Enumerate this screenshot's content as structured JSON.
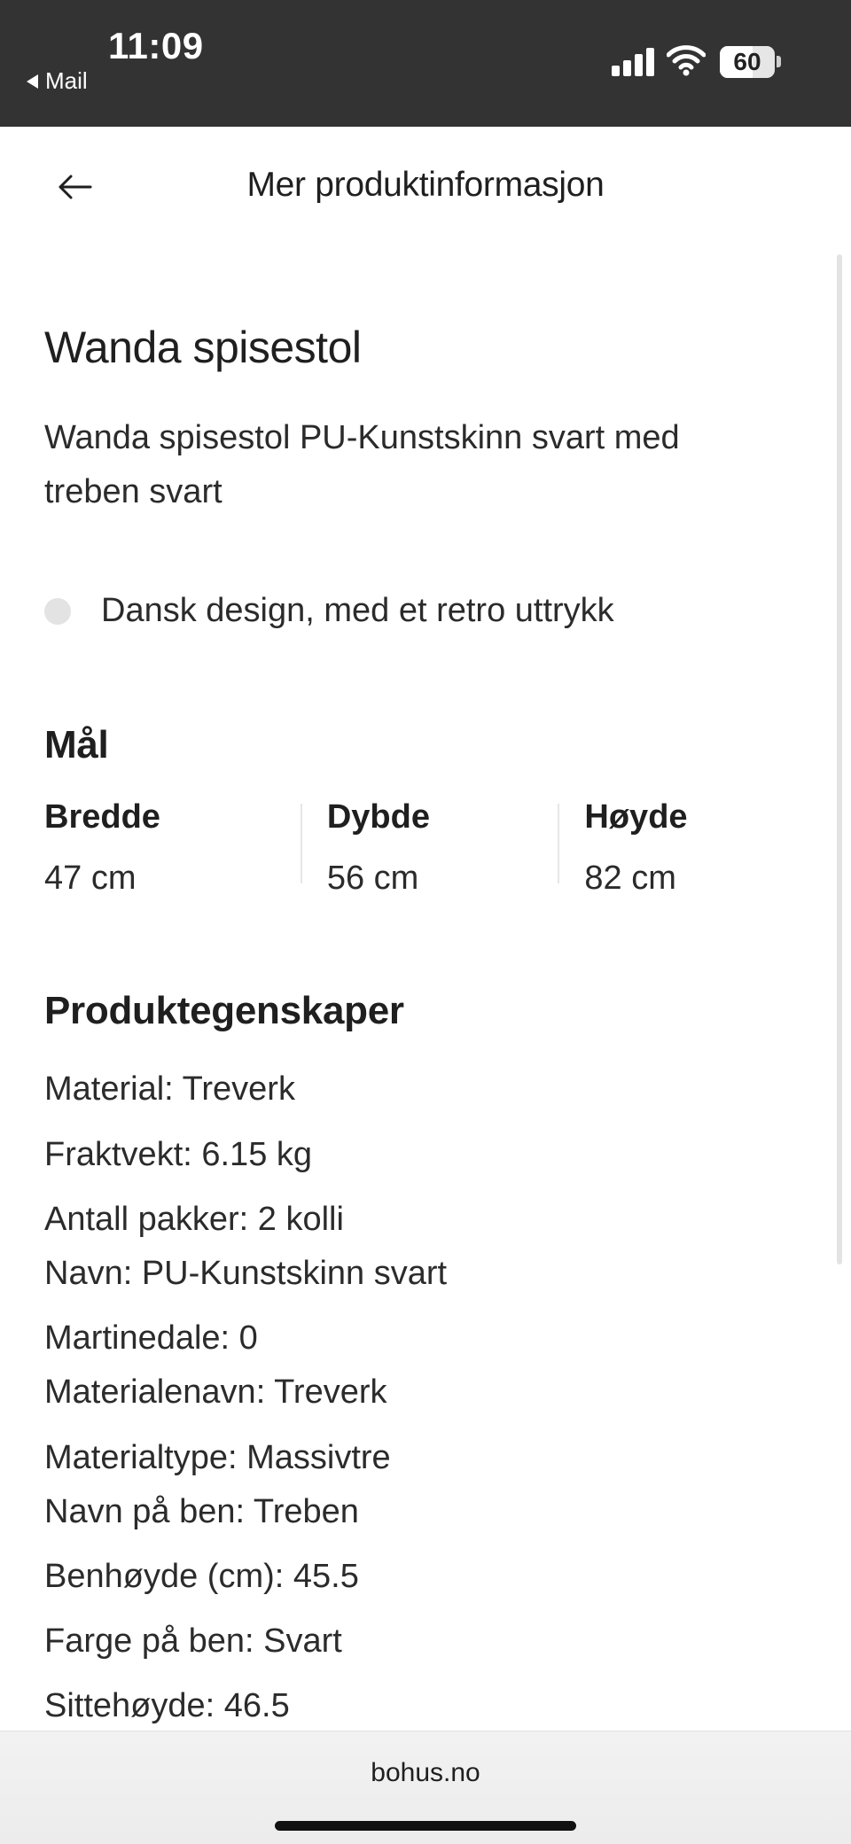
{
  "status_bar": {
    "time": "11:09",
    "back_label": "Mail",
    "battery": "60",
    "battery_level": 0.6,
    "icons": [
      "signal-icon",
      "wifi-icon",
      "battery-icon"
    ]
  },
  "header": {
    "title": "Mer produktinformasjon",
    "back_icon": "arrow-left-icon"
  },
  "product": {
    "title": "Wanda spisestol",
    "description": "Wanda spisestol PU-Kunstskinn svart med treben svart",
    "bullets": [
      "Dansk design, med et retro uttrykk"
    ]
  },
  "dimensions": {
    "heading": "Mål",
    "items": [
      {
        "label": "Bredde",
        "value": "47 cm"
      },
      {
        "label": "Dybde",
        "value": "56 cm"
      },
      {
        "label": "Høyde",
        "value": "82 cm"
      }
    ]
  },
  "properties": {
    "heading": "Produktegenskaper",
    "items": [
      "Material: Treverk",
      "Fraktvekt: 6.15 kg",
      "Antall pakker: 2 kolli",
      "Navn: PU-Kunstskinn svart",
      "Martinedale: 0",
      "Materialenavn: Treverk",
      "Materialtype: Massivtre",
      "Navn på ben: Treben",
      "Benhøyde (cm): 45.5",
      "Farge på ben: Svart",
      "Sittehøyde: 46.5"
    ]
  },
  "browser": {
    "url": "bohus.no"
  }
}
